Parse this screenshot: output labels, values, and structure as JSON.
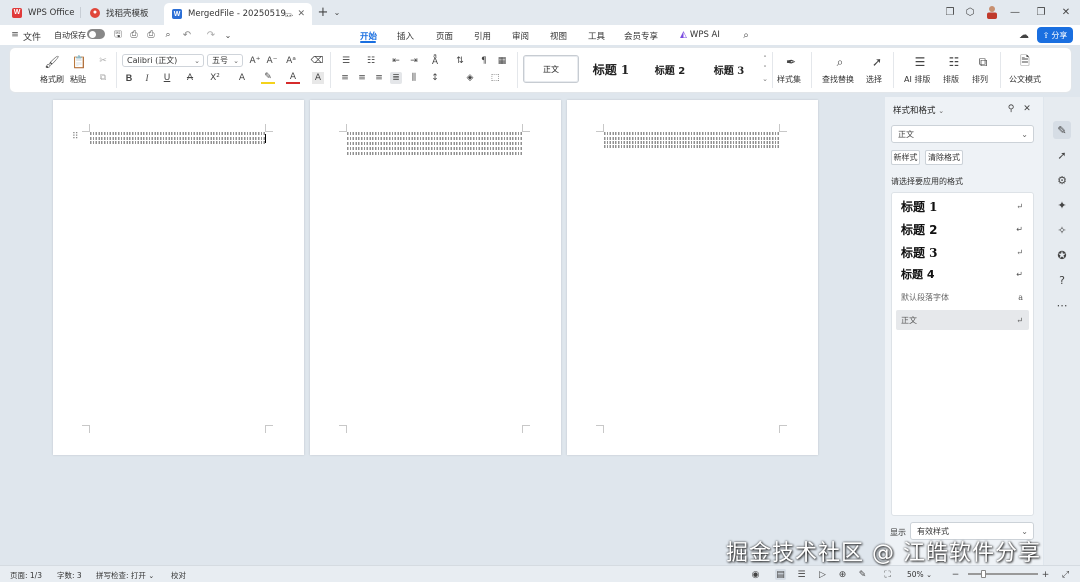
{
  "tabs": [
    {
      "label": "WPS Office",
      "icon": "wps-logo-icon",
      "color": "#e03a3a"
    },
    {
      "label": "找稻壳模板",
      "icon": "docer-icon",
      "color": "#e0463a"
    },
    {
      "label": "MergedFile - 20250519…",
      "icon": "word-doc-icon",
      "color": "#2b6fd6",
      "active": true
    }
  ],
  "menu": {
    "file": "文件",
    "autosave": "自动保存",
    "items": [
      "开始",
      "插入",
      "页面",
      "引用",
      "审阅",
      "视图",
      "工具",
      "会员专享"
    ],
    "active": "开始",
    "wps_ai": "WPS AI",
    "share": "分享"
  },
  "ribbon": {
    "format_painter": "格式刷",
    "paste": "粘贴",
    "font_name": "Calibri (正文)",
    "font_size": "五号",
    "style_gallery": [
      {
        "label": "正文",
        "selected": true
      },
      {
        "label": "标题 1"
      },
      {
        "label": "标题 2"
      },
      {
        "label": "标题 3"
      }
    ],
    "style_set": "样式集",
    "find_replace": "查找替换",
    "select": "选择",
    "ai_layout": "AI 排版",
    "layout": "排版",
    "arrange": "排列",
    "official_format": "公文模式"
  },
  "panel": {
    "title": "样式和格式",
    "current_style": "正文",
    "new_style": "新样式",
    "clear_format": "清除格式",
    "hint": "请选择要应用的格式",
    "styles": [
      {
        "label": "标题 1",
        "mark": "↵"
      },
      {
        "label": "标题 2",
        "mark": "↵"
      },
      {
        "label": "标题 3",
        "mark": "↵"
      },
      {
        "label": "标题 4",
        "mark": "↵"
      },
      {
        "label": "默认段落字体",
        "mark": "a"
      },
      {
        "label": "正文",
        "mark": "↵",
        "selected": true
      }
    ],
    "show_label": "显示",
    "show_value": "有效样式"
  },
  "statusbar": {
    "page": "页面: 1/3",
    "words": "字数: 3",
    "spellcheck": "拼写检查: 打开",
    "proofread": "校对",
    "zoom": "50%"
  },
  "watermark": "掘金技术社区 @ 江皓软件分享",
  "colors": {
    "accent": "#1a6fe0",
    "highlight": "#f4d21b",
    "font_color": "#d62b2b"
  }
}
